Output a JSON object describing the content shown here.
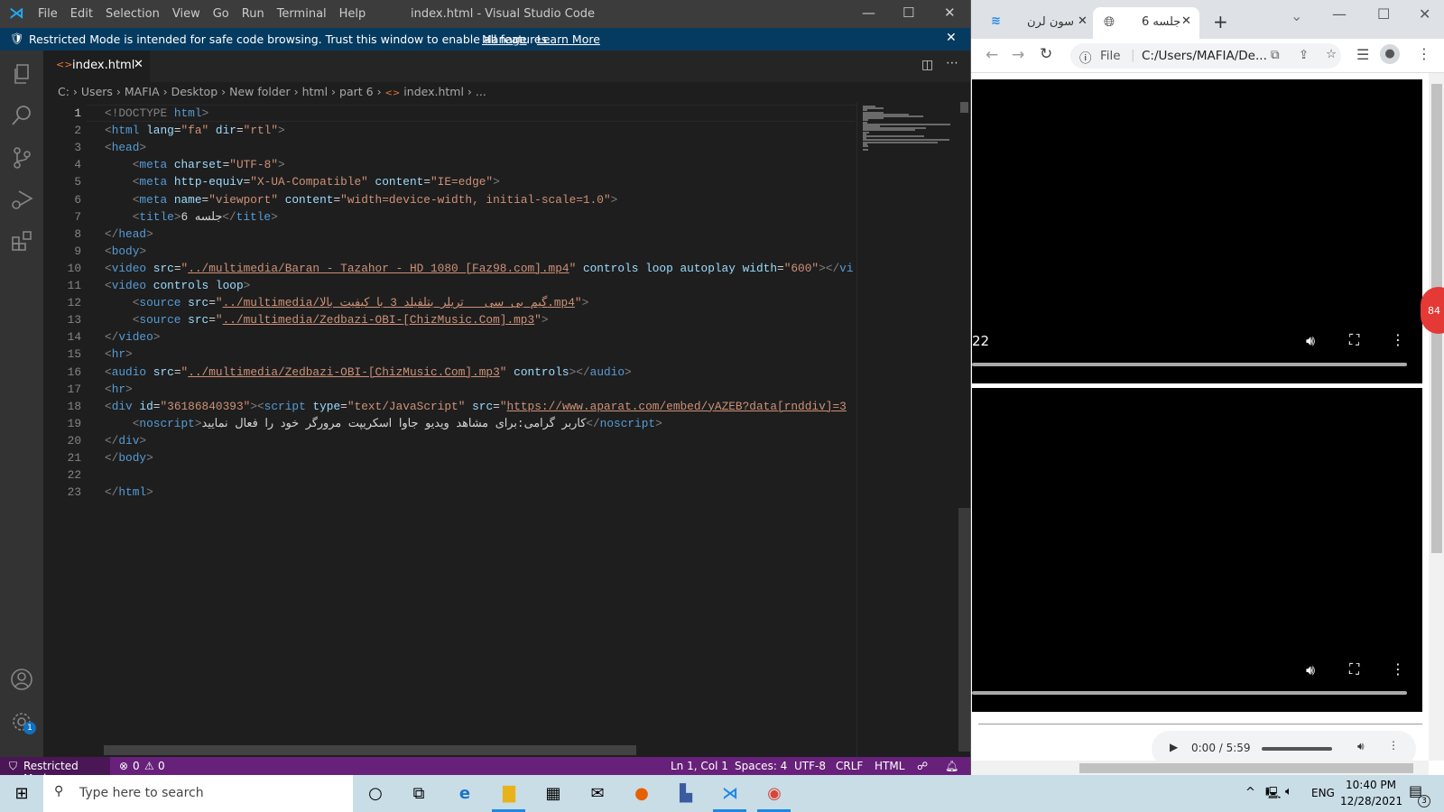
{
  "vscode": {
    "menu": [
      "File",
      "Edit",
      "Selection",
      "View",
      "Go",
      "Run",
      "Terminal",
      "Help"
    ],
    "window_title": "index.html - Visual Studio Code",
    "banner": {
      "text": "Restricted Mode is intended for safe code browsing. Trust this window to enable all features.",
      "manage": "Manage",
      "learn_more": "Learn More"
    },
    "tab": {
      "label": "index.html"
    },
    "breadcrumb": [
      "C:",
      "Users",
      "MAFIA",
      "Desktop",
      "New folder",
      "html",
      "part 6",
      "index.html",
      "..."
    ],
    "settings_badge": "1",
    "code_lines": [
      [
        [
          "p",
          "<"
        ],
        [
          "p",
          "!DOCTYPE "
        ],
        [
          "n",
          "html"
        ],
        [
          "p",
          ">"
        ]
      ],
      [
        [
          "p",
          "<"
        ],
        [
          "n",
          "html"
        ],
        [
          "x",
          " "
        ],
        [
          "a",
          "lang"
        ],
        [
          "x",
          "="
        ],
        [
          "s",
          "\"fa\""
        ],
        [
          "x",
          " "
        ],
        [
          "a",
          "dir"
        ],
        [
          "x",
          "="
        ],
        [
          "s",
          "\"rtl\""
        ],
        [
          "p",
          ">"
        ]
      ],
      [
        [
          "p",
          "<"
        ],
        [
          "n",
          "head"
        ],
        [
          "p",
          ">"
        ]
      ],
      [
        [
          "x",
          "    "
        ],
        [
          "p",
          "<"
        ],
        [
          "n",
          "meta"
        ],
        [
          "x",
          " "
        ],
        [
          "a",
          "charset"
        ],
        [
          "x",
          "="
        ],
        [
          "s",
          "\"UTF-8\""
        ],
        [
          "p",
          ">"
        ]
      ],
      [
        [
          "x",
          "    "
        ],
        [
          "p",
          "<"
        ],
        [
          "n",
          "meta"
        ],
        [
          "x",
          " "
        ],
        [
          "a",
          "http-equiv"
        ],
        [
          "x",
          "="
        ],
        [
          "s",
          "\"X-UA-Compatible\""
        ],
        [
          "x",
          " "
        ],
        [
          "a",
          "content"
        ],
        [
          "x",
          "="
        ],
        [
          "s",
          "\"IE=edge\""
        ],
        [
          "p",
          ">"
        ]
      ],
      [
        [
          "x",
          "    "
        ],
        [
          "p",
          "<"
        ],
        [
          "n",
          "meta"
        ],
        [
          "x",
          " "
        ],
        [
          "a",
          "name"
        ],
        [
          "x",
          "="
        ],
        [
          "s",
          "\"viewport\""
        ],
        [
          "x",
          " "
        ],
        [
          "a",
          "content"
        ],
        [
          "x",
          "="
        ],
        [
          "s",
          "\"width=device-width, initial-scale=1.0\""
        ],
        [
          "p",
          ">"
        ]
      ],
      [
        [
          "x",
          "    "
        ],
        [
          "p",
          "<"
        ],
        [
          "n",
          "title"
        ],
        [
          "p",
          ">"
        ],
        [
          "x",
          "جلسه 6"
        ],
        [
          "p",
          "</"
        ],
        [
          "n",
          "title"
        ],
        [
          "p",
          ">"
        ]
      ],
      [
        [
          "p",
          "</"
        ],
        [
          "n",
          "head"
        ],
        [
          "p",
          ">"
        ]
      ],
      [
        [
          "p",
          "<"
        ],
        [
          "n",
          "body"
        ],
        [
          "p",
          ">"
        ]
      ],
      [
        [
          "p",
          "<"
        ],
        [
          "n",
          "video"
        ],
        [
          "x",
          " "
        ],
        [
          "a",
          "src"
        ],
        [
          "x",
          "="
        ],
        [
          "s",
          "\""
        ],
        [
          "u",
          "../multimedia/Baran - Tazahor - HD 1080 [Faz98.com].mp4"
        ],
        [
          "s",
          "\""
        ],
        [
          "x",
          " "
        ],
        [
          "a",
          "controls"
        ],
        [
          "x",
          " "
        ],
        [
          "a",
          "loop"
        ],
        [
          "x",
          " "
        ],
        [
          "a",
          "autoplay"
        ],
        [
          "x",
          " "
        ],
        [
          "a",
          "width"
        ],
        [
          "x",
          "="
        ],
        [
          "s",
          "\"600\""
        ],
        [
          "p",
          "></"
        ],
        [
          "n",
          "vi"
        ]
      ],
      [
        [
          "p",
          "<"
        ],
        [
          "n",
          "video"
        ],
        [
          "x",
          " "
        ],
        [
          "a",
          "controls"
        ],
        [
          "x",
          " "
        ],
        [
          "a",
          "loop"
        ],
        [
          "p",
          ">"
        ]
      ],
      [
        [
          "x",
          "    "
        ],
        [
          "p",
          "<"
        ],
        [
          "n",
          "source"
        ],
        [
          "x",
          " "
        ],
        [
          "a",
          "src"
        ],
        [
          "x",
          "="
        ],
        [
          "s",
          "\""
        ],
        [
          "u",
          "../multimedia/گیم بی سی _ تریلر بتلفیلد 3 با کیفیت بالا.mp4"
        ],
        [
          "s",
          "\""
        ],
        [
          "p",
          ">"
        ]
      ],
      [
        [
          "x",
          "    "
        ],
        [
          "p",
          "<"
        ],
        [
          "n",
          "source"
        ],
        [
          "x",
          " "
        ],
        [
          "a",
          "src"
        ],
        [
          "x",
          "="
        ],
        [
          "s",
          "\""
        ],
        [
          "u",
          "../multimedia/Zedbazi-OBI-[ChizMusic.Com].mp3"
        ],
        [
          "s",
          "\""
        ],
        [
          "p",
          ">"
        ]
      ],
      [
        [
          "p",
          "</"
        ],
        [
          "n",
          "video"
        ],
        [
          "p",
          ">"
        ]
      ],
      [
        [
          "p",
          "<"
        ],
        [
          "n",
          "hr"
        ],
        [
          "p",
          ">"
        ]
      ],
      [
        [
          "p",
          "<"
        ],
        [
          "n",
          "audio"
        ],
        [
          "x",
          " "
        ],
        [
          "a",
          "src"
        ],
        [
          "x",
          "="
        ],
        [
          "s",
          "\""
        ],
        [
          "u",
          "../multimedia/Zedbazi-OBI-[ChizMusic.Com].mp3"
        ],
        [
          "s",
          "\""
        ],
        [
          "x",
          " "
        ],
        [
          "a",
          "controls"
        ],
        [
          "p",
          "></"
        ],
        [
          "n",
          "audio"
        ],
        [
          "p",
          ">"
        ]
      ],
      [
        [
          "p",
          "<"
        ],
        [
          "n",
          "hr"
        ],
        [
          "p",
          ">"
        ]
      ],
      [
        [
          "p",
          "<"
        ],
        [
          "n",
          "div"
        ],
        [
          "x",
          " "
        ],
        [
          "a",
          "id"
        ],
        [
          "x",
          "="
        ],
        [
          "s",
          "\"36186840393\""
        ],
        [
          "p",
          "><"
        ],
        [
          "n",
          "script"
        ],
        [
          "x",
          " "
        ],
        [
          "a",
          "type"
        ],
        [
          "x",
          "="
        ],
        [
          "s",
          "\"text/JavaScript\""
        ],
        [
          "x",
          " "
        ],
        [
          "a",
          "src"
        ],
        [
          "x",
          "="
        ],
        [
          "s",
          "\""
        ],
        [
          "u",
          "https://www.aparat.com/embed/yAZEB?data[rnddiv]=3"
        ]
      ],
      [
        [
          "x",
          "    "
        ],
        [
          "p",
          "<"
        ],
        [
          "n",
          "noscript"
        ],
        [
          "p",
          ">"
        ],
        [
          "x",
          "کاربر گرامی:برای مشاهد ویدیو جاوا اسکریپت مرورگر خود را فعال نمایید"
        ],
        [
          "p",
          "</"
        ],
        [
          "n",
          "noscript"
        ],
        [
          "p",
          ">"
        ]
      ],
      [
        [
          "p",
          "</"
        ],
        [
          "n",
          "div"
        ],
        [
          "p",
          ">"
        ]
      ],
      [
        [
          "p",
          "</"
        ],
        [
          "n",
          "body"
        ],
        [
          "p",
          ">"
        ]
      ],
      [],
      [
        [
          "p",
          "</"
        ],
        [
          "n",
          "html"
        ],
        [
          "p",
          ">"
        ]
      ]
    ],
    "status": {
      "mode": "Restricted Mode",
      "errors": "0",
      "warnings": "0",
      "position": "Ln 1, Col 1",
      "spaces": "Spaces: 4",
      "encoding": "UTF-8",
      "eol": "CRLF",
      "language": "HTML"
    }
  },
  "browser": {
    "tabs": [
      {
        "label": "سون لرن"
      },
      {
        "label": "جلسه 6"
      }
    ],
    "address": {
      "scheme": "File",
      "url": "C:/Users/MAFIA/De..."
    },
    "video1_time": "22",
    "audio_time": "0:00 / 5:59",
    "notification_badge": "84"
  },
  "taskbar": {
    "search_placeholder": "Type here to search",
    "language": "ENG",
    "time": "10:40 PM",
    "date": "12/28/2021",
    "notifications": "3"
  },
  "colors": {
    "status_bar": "#68217a",
    "banner": "#063b61",
    "accent": "#0078d4"
  }
}
